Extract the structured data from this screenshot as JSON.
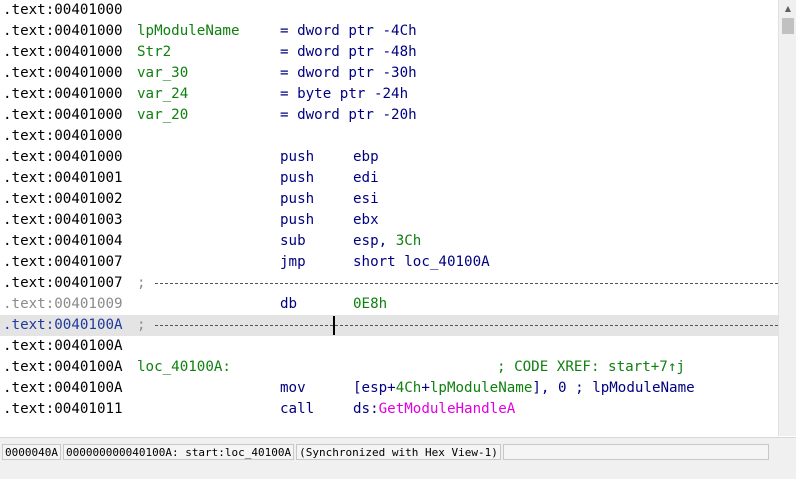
{
  "listing": [
    {
      "addr": ".text:00401000",
      "kind": "blank"
    },
    {
      "addr": ".text:00401000",
      "kind": "var",
      "name": "lpModuleName",
      "def": "= dword ptr -4Ch"
    },
    {
      "addr": ".text:00401000",
      "kind": "var",
      "name": "Str2",
      "def": "= dword ptr -48h"
    },
    {
      "addr": ".text:00401000",
      "kind": "var",
      "name": "var_30",
      "def": "= dword ptr -30h"
    },
    {
      "addr": ".text:00401000",
      "kind": "var",
      "name": "var_24",
      "def": "= byte ptr -24h"
    },
    {
      "addr": ".text:00401000",
      "kind": "var",
      "name": "var_20",
      "def": "= dword ptr -20h"
    },
    {
      "addr": ".text:00401000",
      "kind": "blank"
    },
    {
      "addr": ".text:00401000",
      "kind": "ins",
      "mnem": "push",
      "ops": "ebp"
    },
    {
      "addr": ".text:00401001",
      "kind": "ins",
      "mnem": "push",
      "ops": "edi"
    },
    {
      "addr": ".text:00401002",
      "kind": "ins",
      "mnem": "push",
      "ops": "esi"
    },
    {
      "addr": ".text:00401003",
      "kind": "ins",
      "mnem": "push",
      "ops": "ebx"
    },
    {
      "addr": ".text:00401004",
      "kind": "ins",
      "mnem": "sub",
      "ops_pre": "esp, ",
      "ops_num": "3Ch"
    },
    {
      "addr": ".text:00401007",
      "kind": "ins",
      "mnem": "jmp",
      "ops": "short loc_40100A"
    },
    {
      "addr": ".text:00401007",
      "kind": "sep",
      "comment": ";"
    },
    {
      "addr": ".text:00401009",
      "kind": "ins",
      "mnem": "db",
      "ops_num": "0E8h",
      "addr_style": "grey"
    },
    {
      "addr": ".text:0040100A",
      "kind": "sep",
      "comment": ";",
      "addr_style": "blue",
      "selected": true
    },
    {
      "addr": ".text:0040100A",
      "kind": "blank"
    },
    {
      "addr": ".text:0040100A",
      "kind": "label",
      "name": "loc_40100A:",
      "xref": "; CODE XREF: start+7↑j"
    },
    {
      "addr": ".text:0040100A",
      "kind": "ins",
      "mnem": "mov",
      "ops_pre": "[esp+",
      "ops_num": "4Ch",
      "ops_mid": "+",
      "ops_num2": "lpModuleName",
      "ops_post": "], 0 ; ",
      "ops_num3": "lpModuleName"
    },
    {
      "addr": ".text:00401011",
      "kind": "ins",
      "mnem": "call",
      "ops_pre": "ds:",
      "ops_imp": "GetModuleHandleA"
    }
  ],
  "status": [
    "0000040A",
    "000000000040100A: start:loc_40100A",
    "(Synchronized with Hex View-1)",
    ""
  ],
  "scroll": {
    "up_icon": "▲"
  }
}
